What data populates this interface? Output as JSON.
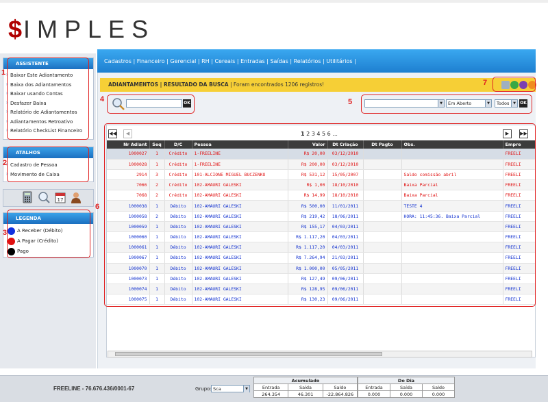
{
  "logo": {
    "dollar": "$",
    "text": "IMPLES"
  },
  "assistente": {
    "title": "ASSISTENTE",
    "items": [
      "Baixar Este Adiantamento",
      "Baixa dos Adiantamentos",
      "Baixar usando Contas",
      "Desfazer Baixa",
      "Relatório de Adiantamentos",
      "Adiantamentos Retroativo",
      "Relatório CheckList Financeiro"
    ]
  },
  "atalhos": {
    "title": "ATALHOS",
    "items": [
      "Cadastro de Pessoa",
      "Movimento de Caixa"
    ]
  },
  "tools": [
    "calculator-icon",
    "search-icon",
    "calendar-icon",
    "user-icon"
  ],
  "legenda": {
    "title": "LEGENDA",
    "items": [
      {
        "label": "A Receber (Débito)",
        "color": "#1030e0"
      },
      {
        "label": "A Pagar (Crédito)",
        "color": "#e01010"
      },
      {
        "label": "Pago",
        "color": "#000000"
      }
    ]
  },
  "menu": {
    "text": "Cadastros | Financeiro | Gerencial | RH | Cereais | Entradas | Saídas | Relatórios | Utilitários |"
  },
  "titlebar": {
    "section": "ADIANTAMENTOS | RESULTADO DA BUSCA",
    "message": "| Foram encontrados 1206 registros!"
  },
  "search": {
    "ok": "OK"
  },
  "filters": {
    "status": "Em Aberto",
    "todos": "Todos",
    "ok": "OK"
  },
  "pager": {
    "current": "1",
    "pages": "2 3 4 5 6 ..."
  },
  "callouts": [
    "1",
    "2",
    "3",
    "4",
    "5",
    "6",
    "7"
  ],
  "table": {
    "headers": [
      "Nr Adiant",
      "Seq",
      "D/C",
      "Pessoa",
      "Valor",
      "Dt Criação",
      "Dt Pagto",
      "Obs.",
      "Empre"
    ],
    "rows": [
      {
        "nr": "1000027",
        "seq": "1",
        "dc": "Crédito",
        "pessoa": "1-FREELINE",
        "valor": "R$ 20,00",
        "dt": "03/12/2010",
        "pg": "",
        "obs": "",
        "emp": "FREELI",
        "color": "#e01010"
      },
      {
        "nr": "1000028",
        "seq": "1",
        "dc": "Crédito",
        "pessoa": "1-FREELINE",
        "valor": "R$ 200,00",
        "dt": "03/12/2010",
        "pg": "",
        "obs": "",
        "emp": "FREELI",
        "color": "#e01010"
      },
      {
        "nr": "2914",
        "seq": "3",
        "dc": "Crédito",
        "pessoa": "101-ALCIONE MIGUEL BUCZENKO",
        "valor": "R$ 531,12",
        "dt": "15/05/2007",
        "pg": "",
        "obs": "Saldo comissão abril",
        "emp": "FREELI",
        "color": "#e01010"
      },
      {
        "nr": "7066",
        "seq": "2",
        "dc": "Crédito",
        "pessoa": "102-AMAURI GALESKI",
        "valor": "R$ 1,00",
        "dt": "18/10/2010",
        "pg": "",
        "obs": "Baixa Parcial",
        "emp": "FREELI",
        "color": "#e01010"
      },
      {
        "nr": "7068",
        "seq": "2",
        "dc": "Crédito",
        "pessoa": "102-AMAURI GALESKI",
        "valor": "R$ 14,99",
        "dt": "18/10/2010",
        "pg": "",
        "obs": "Baixa Parcial",
        "emp": "FREELI",
        "color": "#e01010"
      },
      {
        "nr": "1000038",
        "seq": "1",
        "dc": "Débito",
        "pessoa": "102-AMAURI GALESKI",
        "valor": "R$ 500,00",
        "dt": "11/01/2011",
        "pg": "",
        "obs": "TESTE 4",
        "emp": "FREELI",
        "color": "#1030d0"
      },
      {
        "nr": "1000058",
        "seq": "2",
        "dc": "Débito",
        "pessoa": "102-AMAURI GALESKI",
        "valor": "R$ 219,42",
        "dt": "18/06/2011",
        "pg": "",
        "obs": "HORA: 11:45:36. Baixa Parcial",
        "emp": "FREELI",
        "color": "#1030d0"
      },
      {
        "nr": "1000059",
        "seq": "1",
        "dc": "Débito",
        "pessoa": "102-AMAURI GALESKI",
        "valor": "R$ 155,17",
        "dt": "04/03/2011",
        "pg": "",
        "obs": "",
        "emp": "FREELI",
        "color": "#1030d0"
      },
      {
        "nr": "1000060",
        "seq": "1",
        "dc": "Débito",
        "pessoa": "102-AMAURI GALESKI",
        "valor": "R$ 1.117,20",
        "dt": "04/03/2011",
        "pg": "",
        "obs": "",
        "emp": "FREELI",
        "color": "#1030d0"
      },
      {
        "nr": "1000061",
        "seq": "1",
        "dc": "Débito",
        "pessoa": "102-AMAURI GALESKI",
        "valor": "R$ 1.117,20",
        "dt": "04/03/2011",
        "pg": "",
        "obs": "",
        "emp": "FREELI",
        "color": "#1030d0"
      },
      {
        "nr": "1000067",
        "seq": "1",
        "dc": "Débito",
        "pessoa": "102-AMAURI GALESKI",
        "valor": "R$ 7.264,94",
        "dt": "21/03/2011",
        "pg": "",
        "obs": "",
        "emp": "FREELI",
        "color": "#1030d0"
      },
      {
        "nr": "1000070",
        "seq": "1",
        "dc": "Débito",
        "pessoa": "102-AMAURI GALESKI",
        "valor": "R$ 1.000,00",
        "dt": "05/05/2011",
        "pg": "",
        "obs": "",
        "emp": "FREELI",
        "color": "#1030d0"
      },
      {
        "nr": "1000073",
        "seq": "1",
        "dc": "Débito",
        "pessoa": "102-AMAURI GALESKI",
        "valor": "R$ 127,49",
        "dt": "09/06/2011",
        "pg": "",
        "obs": "",
        "emp": "FREELI",
        "color": "#1030d0"
      },
      {
        "nr": "1000074",
        "seq": "1",
        "dc": "Débito",
        "pessoa": "102-AMAURI GALESKI",
        "valor": "R$ 128,95",
        "dt": "09/06/2011",
        "pg": "",
        "obs": "",
        "emp": "FREELI",
        "color": "#1030d0"
      },
      {
        "nr": "1000075",
        "seq": "1",
        "dc": "Débito",
        "pessoa": "102-AMAURI GALESKI",
        "valor": "R$ 130,23",
        "dt": "09/06/2011",
        "pg": "",
        "obs": "",
        "emp": "FREELI",
        "color": "#1030d0"
      }
    ]
  },
  "status": {
    "company": "FREELINE - 76.676.436/0001-67",
    "grupo_label": "Grupo:",
    "grupo_value": "Sca",
    "acumulado": {
      "title": "Acumulado",
      "entrada_label": "Entrada",
      "saida_label": "Saída",
      "saldo_label": "Saldo",
      "entrada": "264.354",
      "saida": "46.301",
      "saldo": "-22.864.826"
    },
    "dodia": {
      "title": "Do Dia",
      "entrada_label": "Entrada",
      "saida_label": "Saída",
      "saldo_label": "Saldo",
      "entrada": "0.000",
      "saida": "0.000",
      "saldo": "0.000"
    }
  }
}
